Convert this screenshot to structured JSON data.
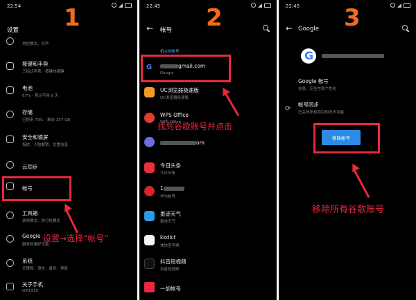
{
  "steps": {
    "one": "1",
    "two": "2",
    "three": "3"
  },
  "panel1": {
    "status_time": "22:54",
    "title": "设置",
    "rows": [
      {
        "title": "",
        "sub": "勿扰模式、铃声"
      },
      {
        "title": "按键和手势",
        "sub": "三指式手势、按键快捷键"
      },
      {
        "title": "电池",
        "sub": "67% - 预计可用 0 天"
      },
      {
        "title": "存储",
        "sub": "已使用 73% - 剩余 157 GB"
      },
      {
        "title": "安全和锁屏",
        "sub": "指纹、人脸解锁、位置信息"
      },
      {
        "title": "云同步",
        "sub": ""
      },
      {
        "title": "帐号",
        "sub": ""
      },
      {
        "title": "工具箱",
        "sub": "游戏模式、防打扰模式"
      },
      {
        "title": "Google",
        "sub": "服务和偏好设置"
      },
      {
        "title": "系统",
        "sub": "无障碍、语言、备份、更新"
      },
      {
        "title": "关于手机",
        "sub": "GM1910"
      }
    ],
    "annotation": "设置→选择“帐号”"
  },
  "panel2": {
    "status_time": "22:45",
    "title": "帐号",
    "section": "机主的帐号",
    "accounts": [
      {
        "title": "gmail.com",
        "sub": "Google"
      },
      {
        "title": "UC浏览器极速版",
        "sub": "UC浏览器极速版"
      },
      {
        "title": "WPS Office",
        "sub": "WPS Office"
      },
      {
        "title": "om",
        "sub": ""
      },
      {
        "title": "今日头条",
        "sub": "今日头条"
      },
      {
        "title": "1",
        "sub": "华为帐号"
      },
      {
        "title": "墨迹天气",
        "sub": "墨迹天气"
      },
      {
        "title": "kkdict",
        "sub": "快快查字典"
      },
      {
        "title": "抖音短视频",
        "sub": "抖音短视频"
      },
      {
        "title": "一加帐号",
        "sub": ""
      }
    ],
    "annotation": "找到谷歌账号并点击"
  },
  "panel3": {
    "status_time": "22:45",
    "title": "Google",
    "google_account_title": "Google 帐号",
    "google_account_sub": "信息、安全性和个性化",
    "sync_title": "帐号同步",
    "sync_sub": "已关闭所有项目的同步功能",
    "remove_button": "移除帐号",
    "annotation": "移除所有谷歌账号"
  },
  "colors": {
    "accent_red": "#e8293f",
    "step_orange": "#f26b1d",
    "button_blue": "#2b8be6"
  }
}
